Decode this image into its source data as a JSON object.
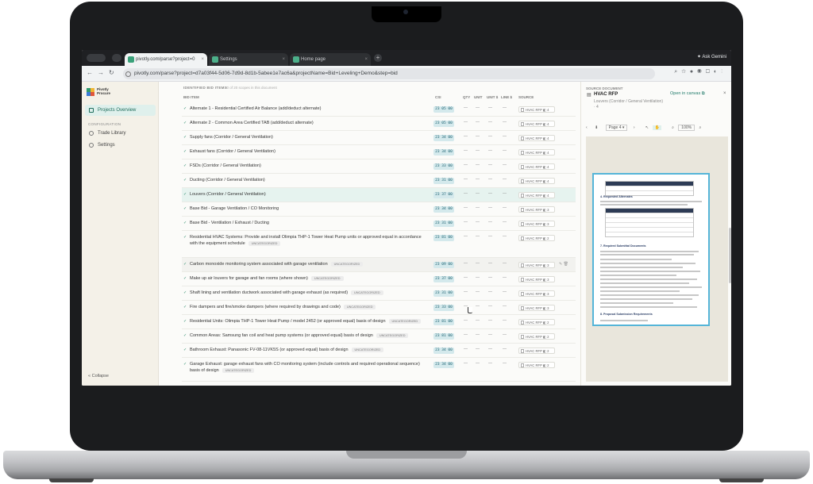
{
  "browser": {
    "tabs": [
      {
        "title": "pivotly.com/parse?project=0",
        "active": true
      },
      {
        "title": "Settings",
        "active": false
      },
      {
        "title": "Home page",
        "active": false
      }
    ],
    "ask_gemini": "Ask Gemini",
    "url": "pivotly.com/parse?project=d7a03f44-5d06-7d9d-8d1b-5abee1e7ac6a&projectName=Bid+Leveling+Demo&step=bid"
  },
  "sidebar": {
    "logo_text_1": "Pivotly",
    "logo_text_2": "Procure",
    "projects_overview": "Projects Overview",
    "section": "CONFIGURATION",
    "trade_library": "Trade Library",
    "settings": "Settings",
    "collapse": "Collapse"
  },
  "table": {
    "title": "IDENTIFIED BID ITEMS",
    "subtitle": "20 of 20 scopes in this document",
    "headers": {
      "bid_item": "BID ITEM",
      "csi": "CSI",
      "qty": "QTY",
      "unit": "UNIT",
      "unit_price": "UNIT $",
      "line_total": "LINE $",
      "source": "SOURCE"
    },
    "rows": [
      {
        "item": "Alternate 1 - Residential Certified Air Balance (add/deduct alternate)",
        "tag": "",
        "csi": "23 05 00",
        "source": "HVAC RFP",
        "page": "4"
      },
      {
        "item": "Alternate 2 - Common Area Certified TAB (add/deduct alternate)",
        "tag": "",
        "csi": "23 05 00",
        "source": "HVAC RFP",
        "page": "4"
      },
      {
        "item": "Supply fans (Corridor / General Ventilation)",
        "tag": "",
        "csi": "23 34 00",
        "source": "HVAC RFP",
        "page": "4"
      },
      {
        "item": "Exhaust fans (Corridor / General Ventilation)",
        "tag": "",
        "csi": "23 34 00",
        "source": "HVAC RFP",
        "page": "4"
      },
      {
        "item": "FSDs (Corridor / General Ventilation)",
        "tag": "",
        "csi": "23 33 00",
        "source": "HVAC RFP",
        "page": "4"
      },
      {
        "item": "Ducting (Corridor / General Ventilation)",
        "tag": "",
        "csi": "23 31 00",
        "source": "HVAC RFP",
        "page": "4"
      },
      {
        "item": "Louvers (Corridor / General Ventilation)",
        "tag": "",
        "csi": "23 37 00",
        "source": "HVAC RFP",
        "page": "4"
      },
      {
        "item": "Base Bid - Garage Ventilation / CO Monitoring",
        "tag": "",
        "csi": "23 34 00",
        "source": "HVAC RFP",
        "page": "3"
      },
      {
        "item": "Base Bid - Ventilation / Exhaust / Ducting",
        "tag": "",
        "csi": "23 31 00",
        "source": "HVAC RFP",
        "page": "3"
      },
      {
        "item": "Residential HVAC Systems: Provide and install Olimpia THP-1 Tower Heat Pump units or approved equal in accordance with the equipment schedule",
        "tag": "UNCATEGORIZED",
        "csi": "23 81 00",
        "source": "HVAC RFP",
        "page": "2"
      },
      {
        "item": "Carbon monoxide monitoring system associated with garage ventilation",
        "tag": "UNCATEGORIZED",
        "csi": "23 09 00",
        "source": "HVAC RFP",
        "page": "3"
      },
      {
        "item": "Make up air louvers for garage and fan rooms (where shown)",
        "tag": "UNCATEGORIZED",
        "csi": "23 37 00",
        "source": "HVAC RFP",
        "page": "3"
      },
      {
        "item": "Shaft lining and ventilation ductwork associated with garage exhaust (as required)",
        "tag": "UNCATEGORIZED",
        "csi": "23 31 00",
        "source": "HVAC RFP",
        "page": "3"
      },
      {
        "item": "Fire dampers and fire/smoke dampers (where required by drawings and code)",
        "tag": "UNCATEGORIZED",
        "csi": "23 33 00",
        "source": "HVAC RFP",
        "page": "3"
      },
      {
        "item": "Residential Units: Olimpia THP-1 Tower Heat Pump / model 2452 (or approved equal) basis of design",
        "tag": "UNCATEGORIZED",
        "csi": "23 81 00",
        "source": "HVAC RFP",
        "page": "2"
      },
      {
        "item": "Common Areas: Samsung fan coil and heat pump systems (or approved equal) basis of design",
        "tag": "UNCATEGORIZED",
        "csi": "23 81 00",
        "source": "HVAC RFP",
        "page": "2"
      },
      {
        "item": "Bathroom Exhaust: Panasonic FV-08-11VK5S (or approved equal) basis of design",
        "tag": "UNCATEGORIZED",
        "csi": "23 34 00",
        "source": "HVAC RFP",
        "page": "2"
      },
      {
        "item": "Garage Exhaust: garage exhaust fans with CO monitoring system (include controls and required operational sequence) basis of design",
        "tag": "UNCATEGORIZED",
        "csi": "23 34 00",
        "source": "HVAC RFP",
        "page": "2"
      }
    ],
    "dash": "—"
  },
  "panel": {
    "label": "SOURCE DOCUMENT",
    "title": "HVAC RFP",
    "open_in_canvas": "Open in canvas",
    "close": "×",
    "breadcrumb": "Louvers (Corridor / General Ventilation) · 4",
    "page_label": "Page 4",
    "zoom": "100%",
    "doc_heading_1": "4. Requested Alternates",
    "doc_heading_2": "7. Required Submittal Documents",
    "doc_heading_3": "8. Proposal Submission Requirements"
  },
  "colors": {
    "accent": "#1f7a6a",
    "highlight_row": "#e6f3ef",
    "csi_badge": "#d4e9ec",
    "doc_border": "#55b5d8"
  }
}
